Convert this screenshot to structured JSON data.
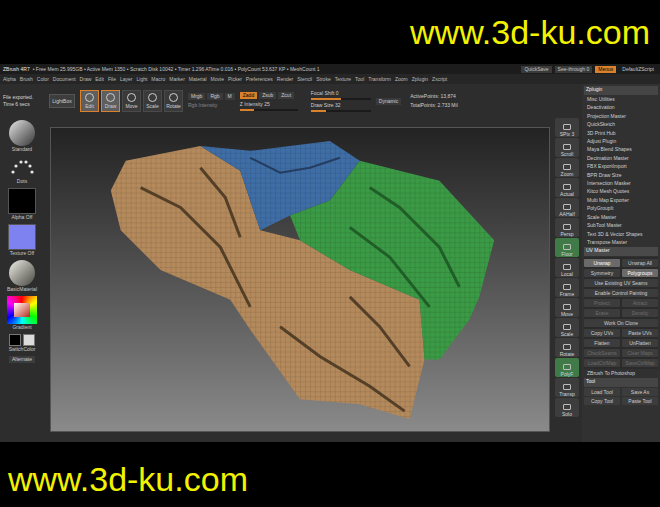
{
  "watermark": {
    "top": "www.3d-ku.com",
    "bottom": "www.3d-ku.com"
  },
  "title_bar": {
    "app": "ZBrush 4R7",
    "stats": "• Free Mem 25.995GB • Active Mem 1350 • Scratch Disk 10042 • Timer 1.296 ATime 0.016 • PolyCount 53.637 KP • MeshCount 1",
    "quicksave": "QuickSave",
    "see_through": "See-through 0",
    "menus": {
      "label": "Menus",
      "selected": true
    },
    "script": "DefaultZScript"
  },
  "menu_bar": [
    "Alpha",
    "Brush",
    "Color",
    "Document",
    "Draw",
    "Edit",
    "File",
    "Layer",
    "Light",
    "Macro",
    "Marker",
    "Material",
    "Movie",
    "Picker",
    "Preferences",
    "Render",
    "Stencil",
    "Stroke",
    "Texture",
    "Tool",
    "Transform",
    "Zoom",
    "Zplugin",
    "Zscript"
  ],
  "notice": "File exported. Time 6 secs",
  "toolbar": {
    "lightbox": "LightBox",
    "modes": [
      {
        "label": "Edit",
        "selected": true
      },
      {
        "label": "Draw",
        "selected": true
      },
      {
        "label": "Move",
        "selected": false
      },
      {
        "label": "Scale",
        "selected": false
      },
      {
        "label": "Rotate",
        "selected": false
      }
    ],
    "color_modes": [
      {
        "label": "Mrgb",
        "selected": false
      },
      {
        "label": "Rgb",
        "selected": false
      },
      {
        "label": "M",
        "selected": false
      }
    ],
    "rgb_intensity": "Rgb Intensity",
    "z_modes": [
      {
        "label": "Zadd",
        "selected": true
      },
      {
        "label": "Zsub",
        "selected": false
      },
      {
        "label": "Zcut",
        "selected": false
      }
    ],
    "z_intensity": {
      "label": "Z Intensity 25",
      "level": 0.25
    },
    "focal_shift": {
      "label": "Focal Shift 0",
      "level": 0.5
    },
    "draw_size": {
      "label": "Draw Size 32",
      "level": 0.25
    },
    "dynamic": "Dynamic",
    "active_points": "ActivePoints: 13,874",
    "total_points": "TotalPoints: 2.733 Mil"
  },
  "left_shelf": [
    {
      "label": "Standard",
      "kind": "brush"
    },
    {
      "label": "Dots",
      "kind": "stroke"
    },
    {
      "label": "Alpha Off",
      "kind": "alpha"
    },
    {
      "label": "Texture Off",
      "kind": "texture"
    },
    {
      "label": "BasicMaterial",
      "kind": "material"
    },
    {
      "label": "Gradient",
      "kind": "color"
    },
    {
      "label": "SwitchColor",
      "kind": "swatch"
    },
    {
      "label": "Alternate",
      "kind": "button"
    }
  ],
  "right_shelf": [
    {
      "label": "SPix 3",
      "selected": false
    },
    {
      "label": "Scroll",
      "selected": false
    },
    {
      "label": "Zoom",
      "selected": false
    },
    {
      "label": "Actual",
      "selected": false
    },
    {
      "label": "AAHalf",
      "selected": false
    },
    {
      "label": "Persp",
      "selected": false
    },
    {
      "label": "Floor",
      "selected": true
    },
    {
      "label": "Local",
      "selected": false
    },
    {
      "label": "Frame",
      "selected": false
    },
    {
      "label": "Move",
      "selected": false
    },
    {
      "label": "Scale",
      "selected": false
    },
    {
      "label": "Rotate",
      "selected": false
    },
    {
      "label": "PolyF",
      "selected": true
    },
    {
      "label": "Transp",
      "selected": false
    },
    {
      "label": "Solo",
      "selected": false
    }
  ],
  "model": {
    "polygroups": [
      {
        "color": "#b48a5c"
      },
      {
        "color": "#3f6ea6"
      },
      {
        "color": "#3b9a45"
      }
    ]
  },
  "plugin_panel": {
    "title": "Zplugin",
    "items": [
      "Misc Utilities",
      "Deactivation",
      "Projection Master",
      "QuickSketch",
      "3D Print Hub",
      "Adjust Plugin",
      "Maya Blend Shapes",
      "Decimation Master",
      "FBX ExportImport",
      "BPR Draw Size",
      "Intersection Masker",
      "Kitco Mesh Quotes",
      "Multi Map Exporter",
      "PolyGroupIt",
      "Scale Master",
      "SubTool Master",
      "Text 3D & Vector Shapes",
      "Transpose Master"
    ],
    "uv_master": {
      "title": "UV Master",
      "expanded": true,
      "rows": [
        [
          {
            "label": "Unwrap",
            "selected": true,
            "disabled": false
          },
          {
            "label": "Unwrap All",
            "selected": false,
            "disabled": false
          }
        ],
        [
          {
            "label": "Symmetry",
            "selected": false,
            "disabled": false
          },
          {
            "label": "Polygroups",
            "selected": true,
            "disabled": false
          }
        ],
        [
          {
            "label": "Use Existing UV Seams",
            "selected": false,
            "disabled": false
          }
        ],
        [
          {
            "label": "Enable Control Painting",
            "selected": false,
            "disabled": false
          }
        ],
        [
          {
            "label": "Protect",
            "selected": false,
            "disabled": true
          },
          {
            "label": "Attract",
            "selected": false,
            "disabled": true
          }
        ],
        [
          {
            "label": "Erase",
            "selected": false,
            "disabled": true
          },
          {
            "label": "Density",
            "selected": false,
            "disabled": true
          }
        ],
        [
          {
            "label": "Work On Clone",
            "selected": false,
            "disabled": false
          }
        ],
        [
          {
            "label": "Copy UVs",
            "selected": false,
            "disabled": false
          },
          {
            "label": "Paste UVs",
            "selected": false,
            "disabled": false
          }
        ],
        [
          {
            "label": "Flatten",
            "selected": false,
            "disabled": false
          },
          {
            "label": "UnFlatten",
            "selected": false,
            "disabled": false
          }
        ],
        [
          {
            "label": "CheckSeams",
            "selected": false,
            "disabled": true
          },
          {
            "label": "Clear Maps",
            "selected": false,
            "disabled": true
          }
        ],
        [
          {
            "label": "LoadCtrlMap",
            "selected": false,
            "disabled": true
          },
          {
            "label": "SaveCtrlMap",
            "selected": false,
            "disabled": true
          }
        ]
      ]
    },
    "extras": [
      "ZBrush To Photoshop"
    ],
    "tool": {
      "title": "Tool",
      "rows": [
        [
          "Load Tool",
          "Save As"
        ],
        [
          "Copy Tool",
          "Paste Tool"
        ]
      ]
    }
  }
}
